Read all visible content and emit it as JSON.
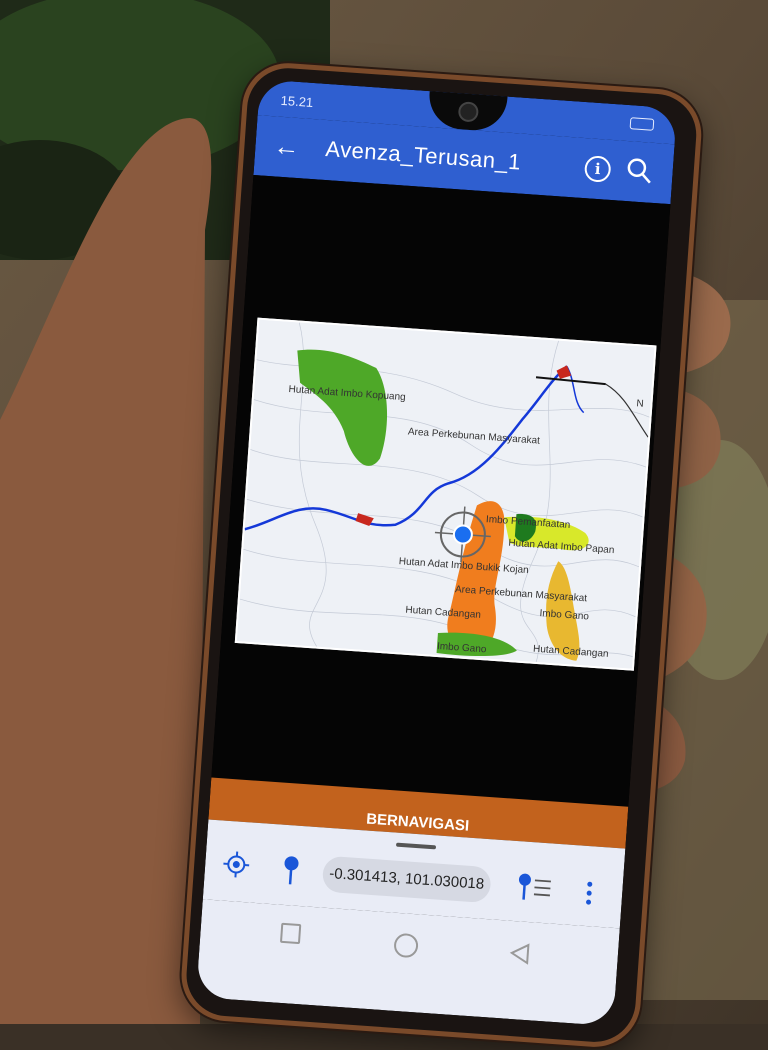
{
  "status_bar": {
    "time": "15.21"
  },
  "app_bar": {
    "title": "Avenza_Terusan_1",
    "back_icon": "arrow-back-icon",
    "info_icon": "info-icon",
    "search_icon": "search-icon"
  },
  "map": {
    "labels": [
      "Hutan Adat Imbo Kopuang",
      "Area Perkebunan Masyarakat",
      "Imbo Pemanfaatan",
      "Hutan Adat Imbo Papan",
      "Hutan Adat Imbo Bukik Kojan",
      "Area Perkebunan Masyarakat",
      "Imbo Gano",
      "Hutan Cadangan",
      "Imbo Gano",
      "Hutan Cadangan"
    ],
    "north_label": "N",
    "colors": {
      "forest_green": "#4ea828",
      "dark_green": "#1e7a1e",
      "orange": "#f07d1e",
      "yellow": "#d8e82a",
      "tan": "#e8b830",
      "river": "#1438d8",
      "red": "#c8281e"
    }
  },
  "navigation": {
    "banner": "BERNAVIGASI",
    "coordinates": "-0.301413, 101.030018"
  },
  "bottom_icons": [
    "locate-icon",
    "pin-icon",
    "pin-list-icon",
    "more-icon"
  ],
  "system_nav": [
    "recent-apps-icon",
    "home-icon",
    "back-triangle-icon"
  ]
}
